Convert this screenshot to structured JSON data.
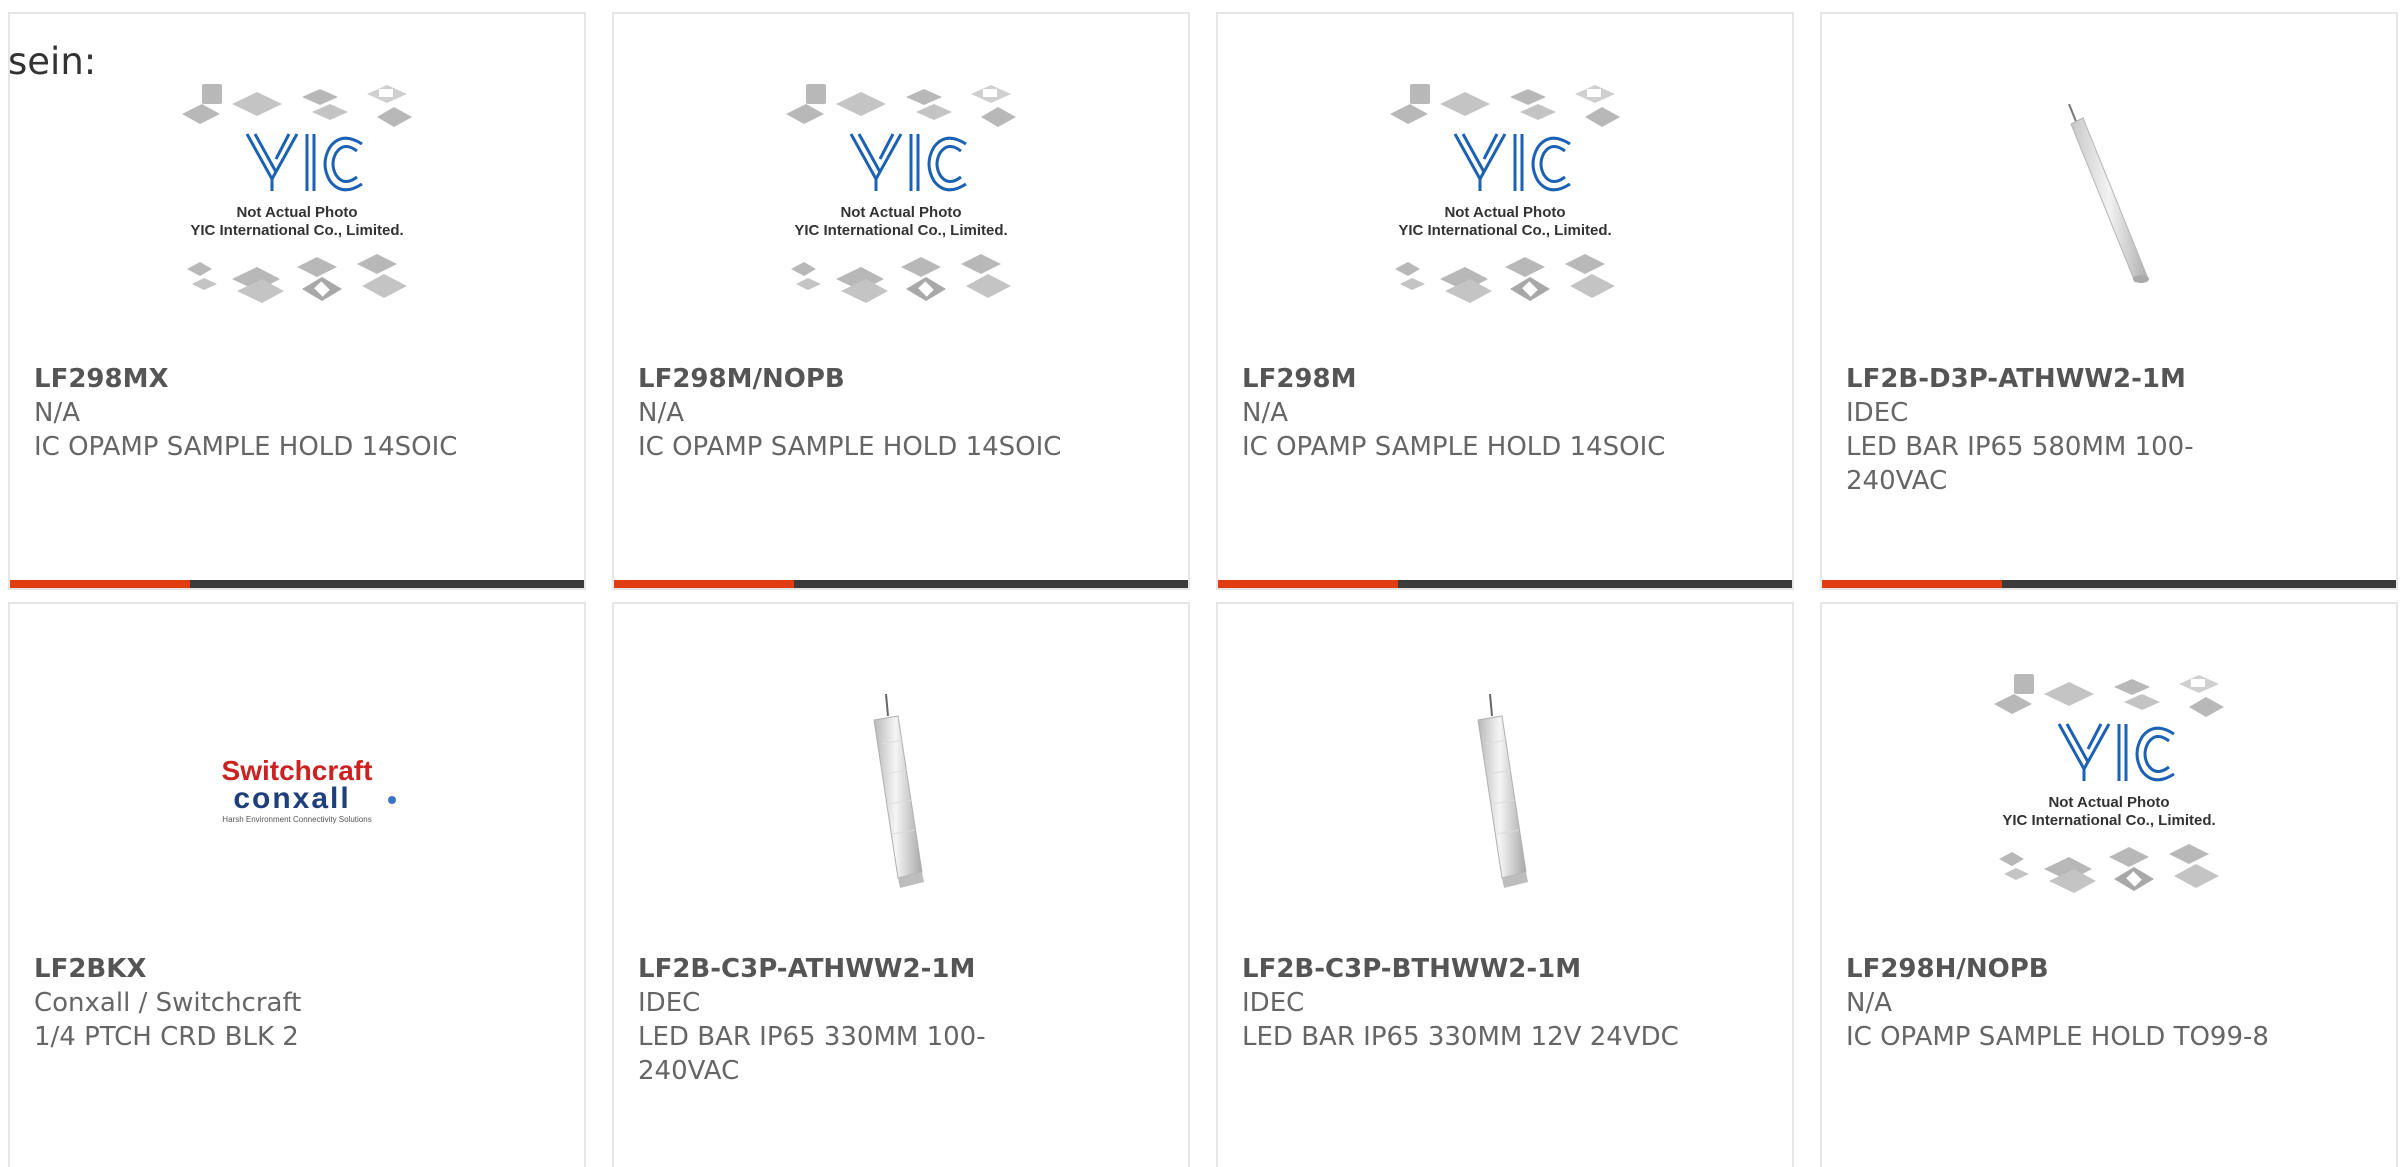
{
  "prefix_text": "sein:",
  "placeholder_caption": {
    "line1": "Not Actual Photo",
    "line2": "YIC International Co., Limited."
  },
  "logo": {
    "brand_top": "Switchcraft",
    "brand_bottom": "conxall",
    "tagline": "Harsh Environment Connectivity Solutions"
  },
  "colors": {
    "accent": "#e03c10",
    "bar": "#3b3b3b",
    "border": "#e6e6e6",
    "text": "#666666"
  },
  "products": [
    {
      "part": "LF298MX",
      "manufacturer": "N/A",
      "description": "IC OPAMP SAMPLE HOLD 14SOIC",
      "image": "placeholder"
    },
    {
      "part": "LF298M/NOPB",
      "manufacturer": "N/A",
      "description": "IC OPAMP SAMPLE HOLD 14SOIC",
      "image": "placeholder"
    },
    {
      "part": "LF298M",
      "manufacturer": "N/A",
      "description": "IC OPAMP SAMPLE HOLD 14SOIC",
      "image": "placeholder"
    },
    {
      "part": "LF2B-D3P-ATHWW2-1M",
      "manufacturer": "IDEC",
      "description": "LED BAR IP65 580MM 100-240VAC",
      "image": "led-bar-thin"
    },
    {
      "part": "LF2BKX",
      "manufacturer": "Conxall / Switchcraft",
      "description": "1/4 PTCH CRD BLK 2",
      "image": "logo"
    },
    {
      "part": "LF2B-C3P-ATHWW2-1M",
      "manufacturer": "IDEC",
      "description": "LED BAR IP65 330MM 100-240VAC",
      "image": "led-bar"
    },
    {
      "part": "LF2B-C3P-BTHWW2-1M",
      "manufacturer": "IDEC",
      "description": "LED BAR IP65 330MM 12V 24VDC",
      "image": "led-bar"
    },
    {
      "part": "LF298H/NOPB",
      "manufacturer": "N/A",
      "description": "IC OPAMP SAMPLE HOLD TO99-8",
      "image": "placeholder"
    }
  ]
}
